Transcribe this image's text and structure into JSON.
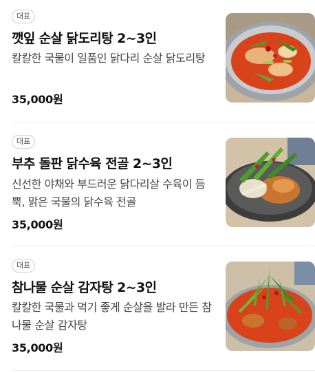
{
  "menu": {
    "items": [
      {
        "badge": "대표",
        "name": "깻잎 순살 닭도리탕 2~3인",
        "description": "칼칼한 국물이 일품인 닭다리 순살 닭도리탕",
        "price": "35,000원",
        "photo": "perilla-chicken-stew-photo"
      },
      {
        "badge": "대표",
        "name": "부추 돌판 닭수육 전골 2~3인",
        "description": "신선한 야채와 부드러운 닭다리살 수육이 듬뿍, 맑은 국물의 닭수육 전골",
        "price": "35,000원",
        "photo": "chive-chicken-hotpot-photo"
      },
      {
        "badge": "대표",
        "name": "참나물 순살 감자탕 2~3인",
        "description": "칼칼한 국물과 먹기 좋게 순살을 발라 만든 참나물 순살 감자탕",
        "price": "35,000원",
        "photo": "chamnamul-potato-stew-photo"
      }
    ]
  },
  "colors": {
    "broth_red": "#d9431c",
    "pot_silver": "#b9bdc2",
    "greens": "#4f9a2e"
  }
}
